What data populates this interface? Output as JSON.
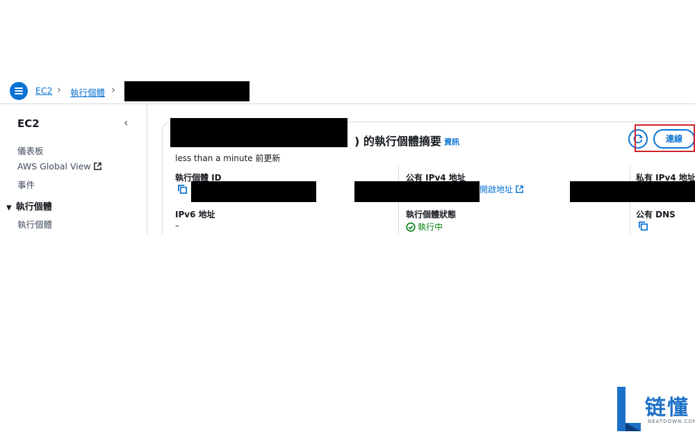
{
  "breadcrumb": {
    "items": [
      "EC2",
      "執行個體"
    ]
  },
  "sidebar": {
    "title": "EC2",
    "items": [
      "儀表板",
      "AWS Global View",
      "事件"
    ],
    "section": "執行個體",
    "section_items": [
      "執行個體"
    ]
  },
  "panel": {
    "title_suffix": ") 的執行個體摘要",
    "info_link": "資訊",
    "updated": "less than a minute 前更新",
    "connect_label": "連線",
    "fields": {
      "instance_id_label": "執行個體 ID",
      "public_ipv4_label": "公有 IPv4 地址",
      "private_ipv4_label": "私有 IPv4 地址",
      "ipv6_label": "IPv6 地址",
      "ipv6_value": "–",
      "instance_state_label": "執行個體狀態",
      "instance_state_value": "執行中",
      "public_dns_label": "公有 DNS",
      "open_address_link": "開啟地址"
    }
  },
  "watermark": {
    "brand": "链懂",
    "domain": "NEATDOWN.COM"
  },
  "colors": {
    "link": "#0972d3",
    "success": "#037f0c",
    "highlight": "#d0222b"
  }
}
